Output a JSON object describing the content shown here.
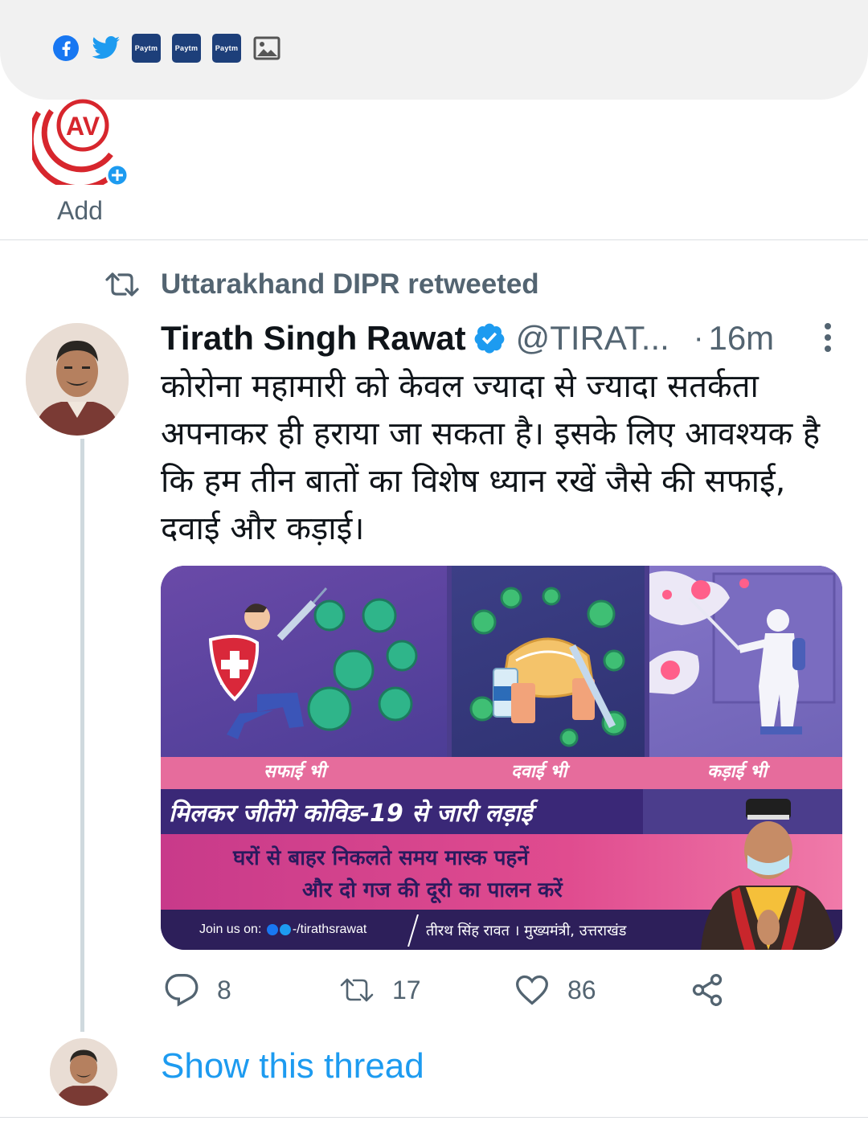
{
  "compose": {
    "icons": [
      "facebook-icon",
      "twitter-icon",
      "paytm-icon",
      "paytm-icon",
      "paytm-icon",
      "image-icon"
    ],
    "paytm_label": "Paytm"
  },
  "fleet": {
    "avatar_text": "AV",
    "label": "Add"
  },
  "retweet": {
    "label": "Uttarakhand DIPR retweeted"
  },
  "tweet": {
    "name": "Tirath Singh Rawat",
    "handle": "@TIRAT...",
    "separator": "·",
    "time": "16m",
    "text": "कोरोना महामारी को केवल ज्यादा से ज्यादा सतर्कता अपनाकर ही हराया जा सकता है। इसके लिए आवश्यक है कि हम तीन बातों का विशेष ध्यान रखें जैसे की सफाई, दवाई और कड़ाई।",
    "media": {
      "label_1": "सफाई भी",
      "label_2": "दवाई भी",
      "label_3": "कड़ाई भी",
      "headline": "मिलकर जीतेंगे कोविड-19 से जारी लड़ाई",
      "message_1": "घरों से बाहर निकलते समय मास्क पहनें",
      "message_2": "और दो गज की दूरी का पालन करें",
      "join_text": "Join us on:",
      "social_handle": "-/tirathsrawat",
      "signature": "तीरथ सिंह रावत । मुख्यमंत्री, उत्तराखंड"
    },
    "actions": {
      "replies": "8",
      "retweets": "17",
      "likes": "86"
    }
  },
  "thread": {
    "show_label": "Show this thread"
  },
  "colors": {
    "accent": "#1d9bf0",
    "secondary_text": "#536471",
    "paytm": "#1d3f7a",
    "fleet_ring": "#d7262d"
  }
}
